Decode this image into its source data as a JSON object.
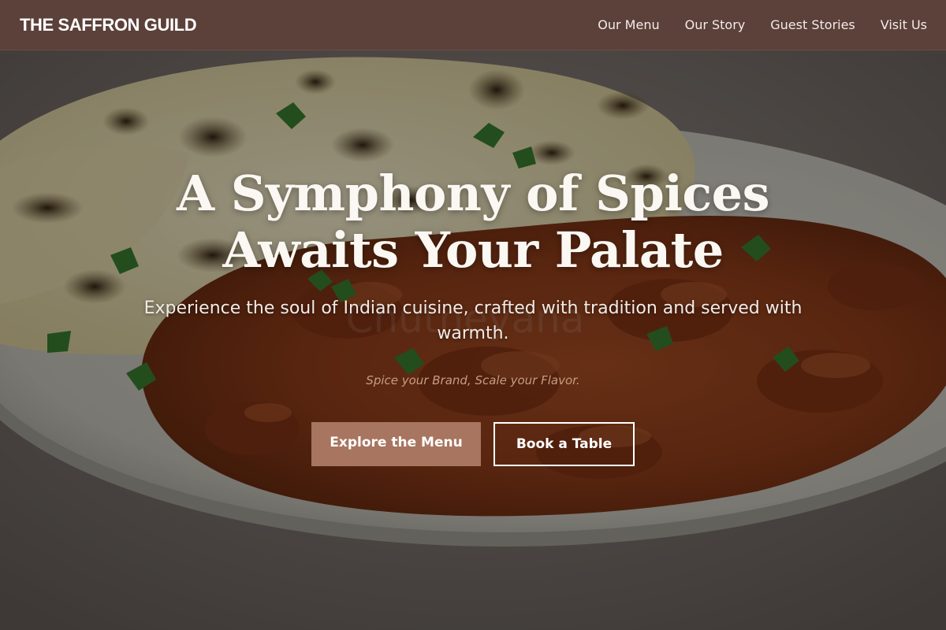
{
  "header": {
    "brand": "THE SAFFRON GUILD",
    "nav": [
      {
        "label": "Our Menu"
      },
      {
        "label": "Our Story"
      },
      {
        "label": "Guest Stories"
      },
      {
        "label": "Visit Us"
      }
    ]
  },
  "hero": {
    "title_line1": "A Symphony of Spices",
    "title_line2": "Awaits Your Palate",
    "subtitle": "Experience the soul of Indian cuisine, crafted with tradition and served with warmth.",
    "tagline": "Spice your Brand, Scale your Flavor.",
    "primary_cta": "Explore the Menu",
    "secondary_cta": "Book a Table",
    "background_image": "naan-and-curry-plate",
    "watermark": "Chutneyana"
  },
  "colors": {
    "nav_background": "#5c403a",
    "primary_button": "#a87560",
    "tagline": "#c79c82",
    "text": "#ffffff"
  }
}
